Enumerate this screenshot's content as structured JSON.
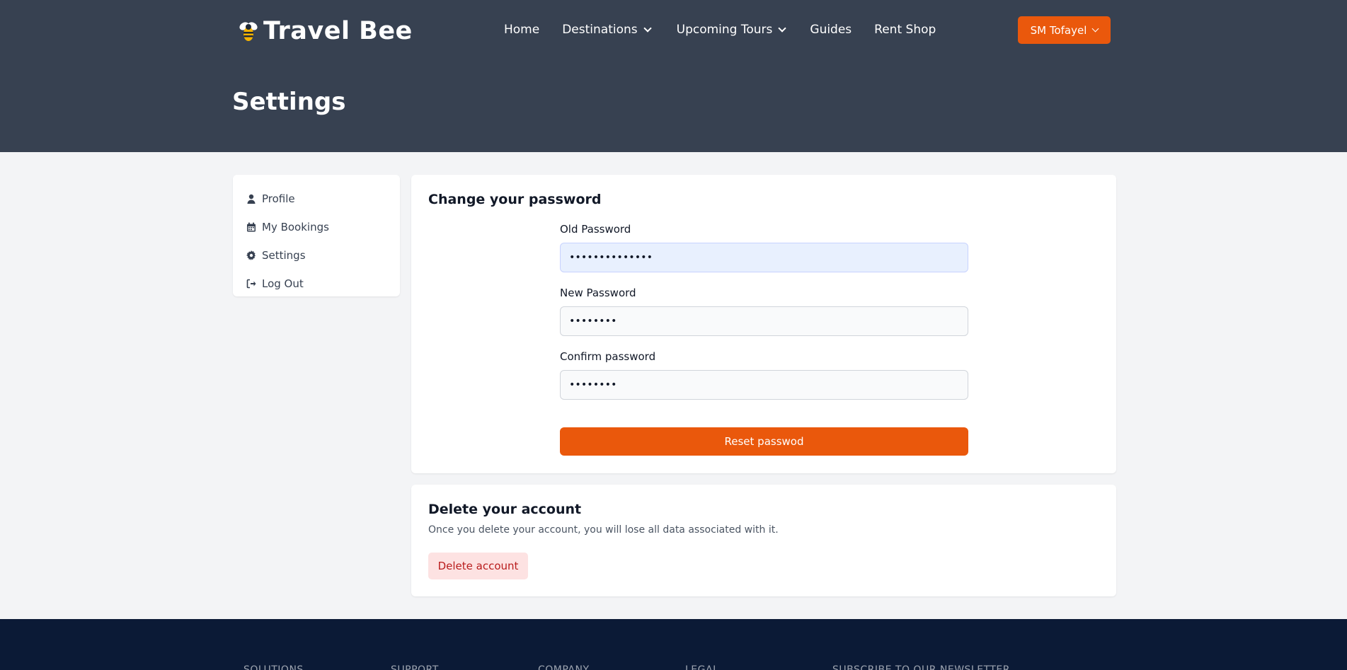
{
  "brand": {
    "name": "Travel Bee",
    "logo_icon": "bee-icon"
  },
  "nav": {
    "items": [
      {
        "label": "Home",
        "dropdown": false
      },
      {
        "label": "Destinations",
        "dropdown": true
      },
      {
        "label": "Upcoming Tours",
        "dropdown": true
      },
      {
        "label": "Guides",
        "dropdown": false
      },
      {
        "label": "Rent Shop",
        "dropdown": false
      }
    ],
    "user": {
      "label": "SM Tofayel"
    }
  },
  "page": {
    "title": "Settings"
  },
  "sidebar": {
    "items": [
      {
        "label": "Profile",
        "icon": "user-icon"
      },
      {
        "label": "My Bookings",
        "icon": "calendar-icon"
      },
      {
        "label": "Settings",
        "icon": "gear-icon"
      },
      {
        "label": "Log Out",
        "icon": "logout-icon"
      }
    ]
  },
  "password_form": {
    "title": "Change your password",
    "old": {
      "label": "Old Password",
      "value": "••••••••••••••"
    },
    "new": {
      "label": "New Password",
      "value": "••••••••"
    },
    "confirm": {
      "label": "Confirm password",
      "value": "••••••••"
    },
    "submit_label": "Reset passwod"
  },
  "delete_account": {
    "title": "Delete your account",
    "description": "Once you delete your account, you will lose all data associated with it.",
    "button_label": "Delete account"
  },
  "footer": {
    "headings": [
      "SOLUTIONS",
      "SUPPORT",
      "COMPANY",
      "LEGAL",
      "SUBSCRIBE TO OUR NEWSLETTER"
    ]
  },
  "colors": {
    "header_bg": "#374151",
    "accent": "#ea580c",
    "page_bg": "#f3f4f6",
    "footer_bg": "#0b1a36",
    "danger_bg": "#fde2e2",
    "danger_text": "#b91c1c"
  }
}
